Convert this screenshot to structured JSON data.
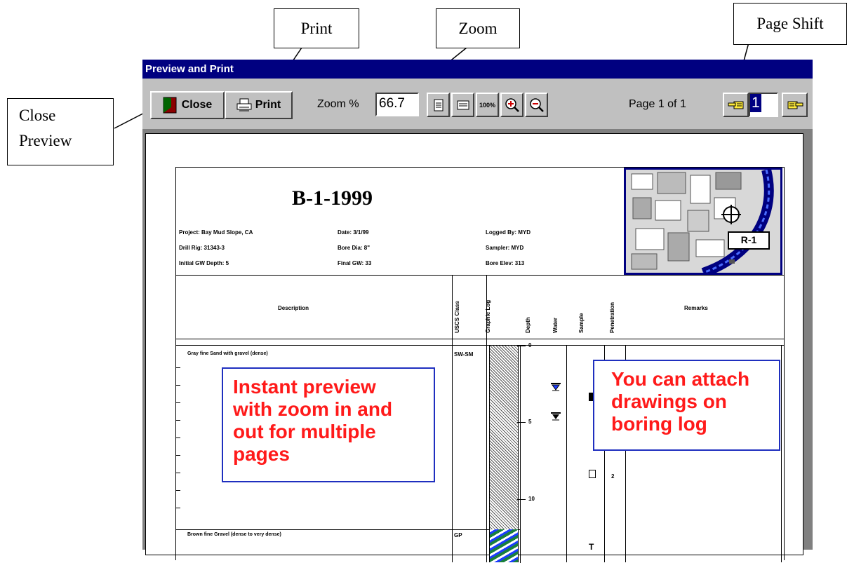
{
  "callouts": {
    "print": "Print",
    "zoom": "Zoom",
    "page_shift": "Page Shift",
    "close_preview_line1": "Close",
    "close_preview_line2": "Preview"
  },
  "window": {
    "title": "Preview and Print"
  },
  "toolbar": {
    "close_label": "Close",
    "print_label": "Print",
    "zoom_label": "Zoom %",
    "zoom_value": "66.7",
    "zoom_100_label": "100%",
    "page_status": "Page 1 of 1",
    "page_value": "1"
  },
  "log": {
    "title": "B-1-1999",
    "project": "Project: Bay Mud Slope, CA",
    "date": "Date: 3/1/99",
    "logged_by": "Logged By: MYD",
    "drill_rig": "Drill Rig: 31343-3",
    "bore_dia": "Bore Dia: 8\"",
    "sampler": "Sampler: MYD",
    "initial_gw": "Initial GW Depth: 5",
    "final_gw": "Final GW: 33",
    "bore_elev": "Bore Elev: 313",
    "map_label": "R-1",
    "columns": [
      "Description",
      "USCS Class",
      "Graphic Log",
      "Depth",
      "Water",
      "Sample",
      "Penetration",
      "Remarks"
    ],
    "layer1_desc": "Gray fine Sand with gravel (dense)",
    "layer1_class": "SW-SM",
    "layer2_desc": "Brown fine Gravel (dense to very dense)",
    "layer2_class": "GP",
    "depth_ticks": [
      "0",
      "5",
      "10"
    ],
    "penetration_values": [
      "2"
    ]
  },
  "annotations": {
    "preview_note": [
      "Instant preview",
      "with zoom in and",
      "out for multiple",
      "pages"
    ],
    "attach_note": [
      "You can attach",
      "drawings on",
      "boring log"
    ]
  },
  "colors": {
    "titlebar": "#000080",
    "annotation_text": "#ff1a1a",
    "annotation_border": "#1f2fbf",
    "window_face": "#c0c0c0"
  }
}
